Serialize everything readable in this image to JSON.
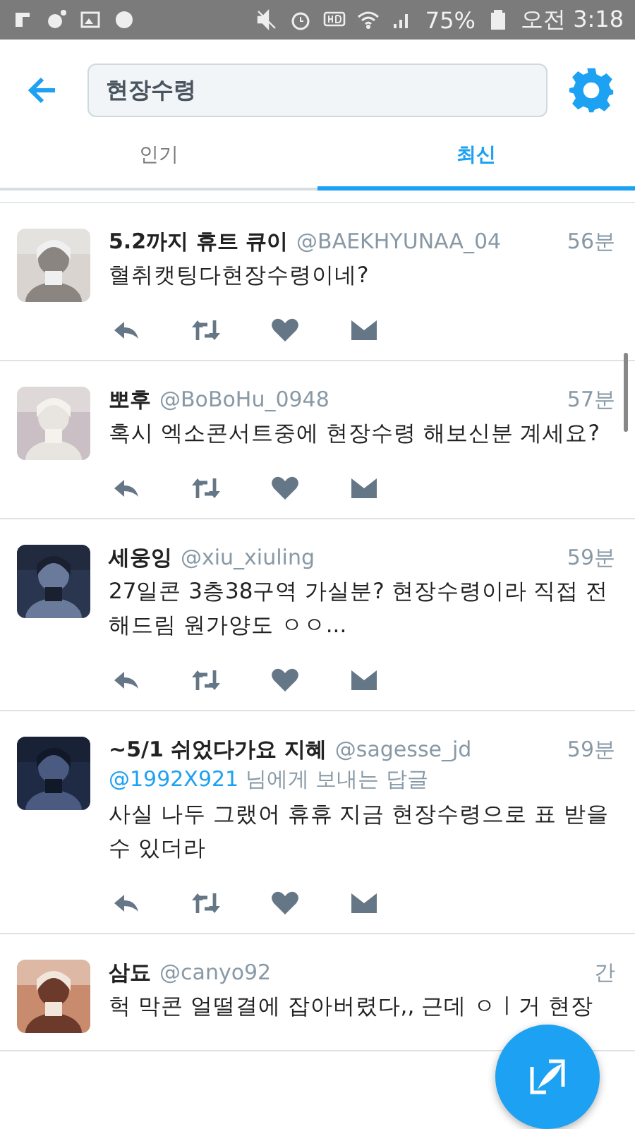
{
  "status_bar": {
    "battery": "75%",
    "time": "오전 3:18"
  },
  "search": {
    "value": "현장수령"
  },
  "tabs": [
    {
      "label": "인기",
      "selected": false
    },
    {
      "label": "최신",
      "selected": true
    }
  ],
  "tweets": [
    {
      "name": "5.2까지 휴트 큐이",
      "handle": "@BAEKHYUNAA_04",
      "time": "56분",
      "body": "혈취캣팅다현장수령이네?",
      "show_actions": true
    },
    {
      "name": "뽀후",
      "handle": "@BoBoHu_0948",
      "time": "57분",
      "body": "혹시 엑소콘서트중에 현장수령 해보신분 계세요?",
      "show_actions": true
    },
    {
      "name": "세웅잉",
      "handle": "@xiu_xiuling",
      "time": "59분",
      "body": "27일콘 3층38구역 가실분? 현장수령이라 직접 전해드림 원가양도 ㅇㅇ...",
      "show_actions": true
    },
    {
      "name": "~5/1 쉬었다가요 지혜",
      "handle": "@sagesse_jd",
      "time": "59분",
      "reply_to": {
        "handle": "@1992X921",
        "text": "님에게 보내는 답글"
      },
      "body": "사실 나두 그랬어 휴휴 지금 현장수령으로 표 받을 수 있더라",
      "show_actions": true
    },
    {
      "name": "삼됴",
      "handle": "@canyo92",
      "time": "간",
      "body": "헉 막콘 얼떨결에 잡아버렸다,, 근데 ㅇㅣ거 현장",
      "show_actions": false
    }
  ]
}
